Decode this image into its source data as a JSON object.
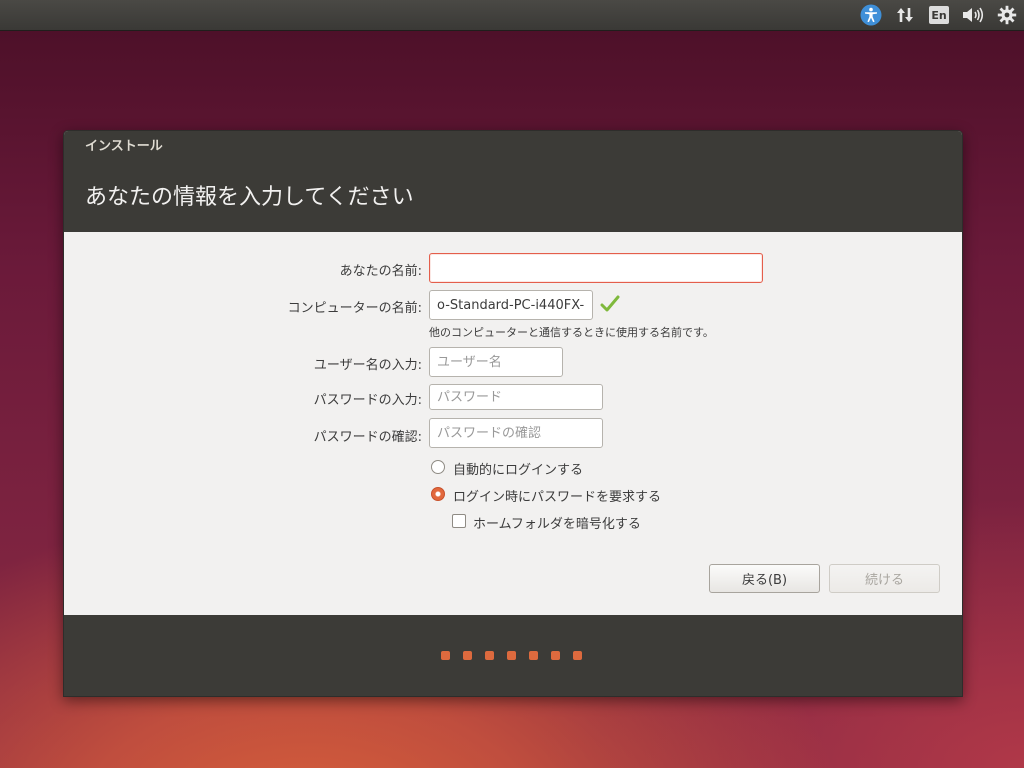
{
  "panel": {
    "lang_label": "En"
  },
  "window": {
    "title": "インストール",
    "heading": "あなたの情報を入力してください"
  },
  "form": {
    "name_label": "あなたの名前:",
    "name_value": "",
    "computer_label": "コンピューターの名前:",
    "computer_value": "o-Standard-PC-i440FX-",
    "computer_hint": "他のコンピューターと通信するときに使用する名前です。",
    "username_label": "ユーザー名の入力:",
    "username_placeholder": "ユーザー名",
    "password_label": "パスワードの入力:",
    "password_placeholder": "パスワード",
    "confirm_label": "パスワードの確認:",
    "confirm_placeholder": "パスワードの確認",
    "auto_login_label": "自動的にログインする",
    "require_password_label": "ログイン時にパスワードを要求する",
    "encrypt_home_label": "ホームフォルダを暗号化する",
    "selected_option": "require_password"
  },
  "buttons": {
    "back": "戻る(B)",
    "continue": "続ける"
  },
  "progress": {
    "steps": 7
  },
  "colors": {
    "accent": "#dd6a3e",
    "titlebar": "#3c3b37",
    "ok_check": "#7fb93c"
  }
}
